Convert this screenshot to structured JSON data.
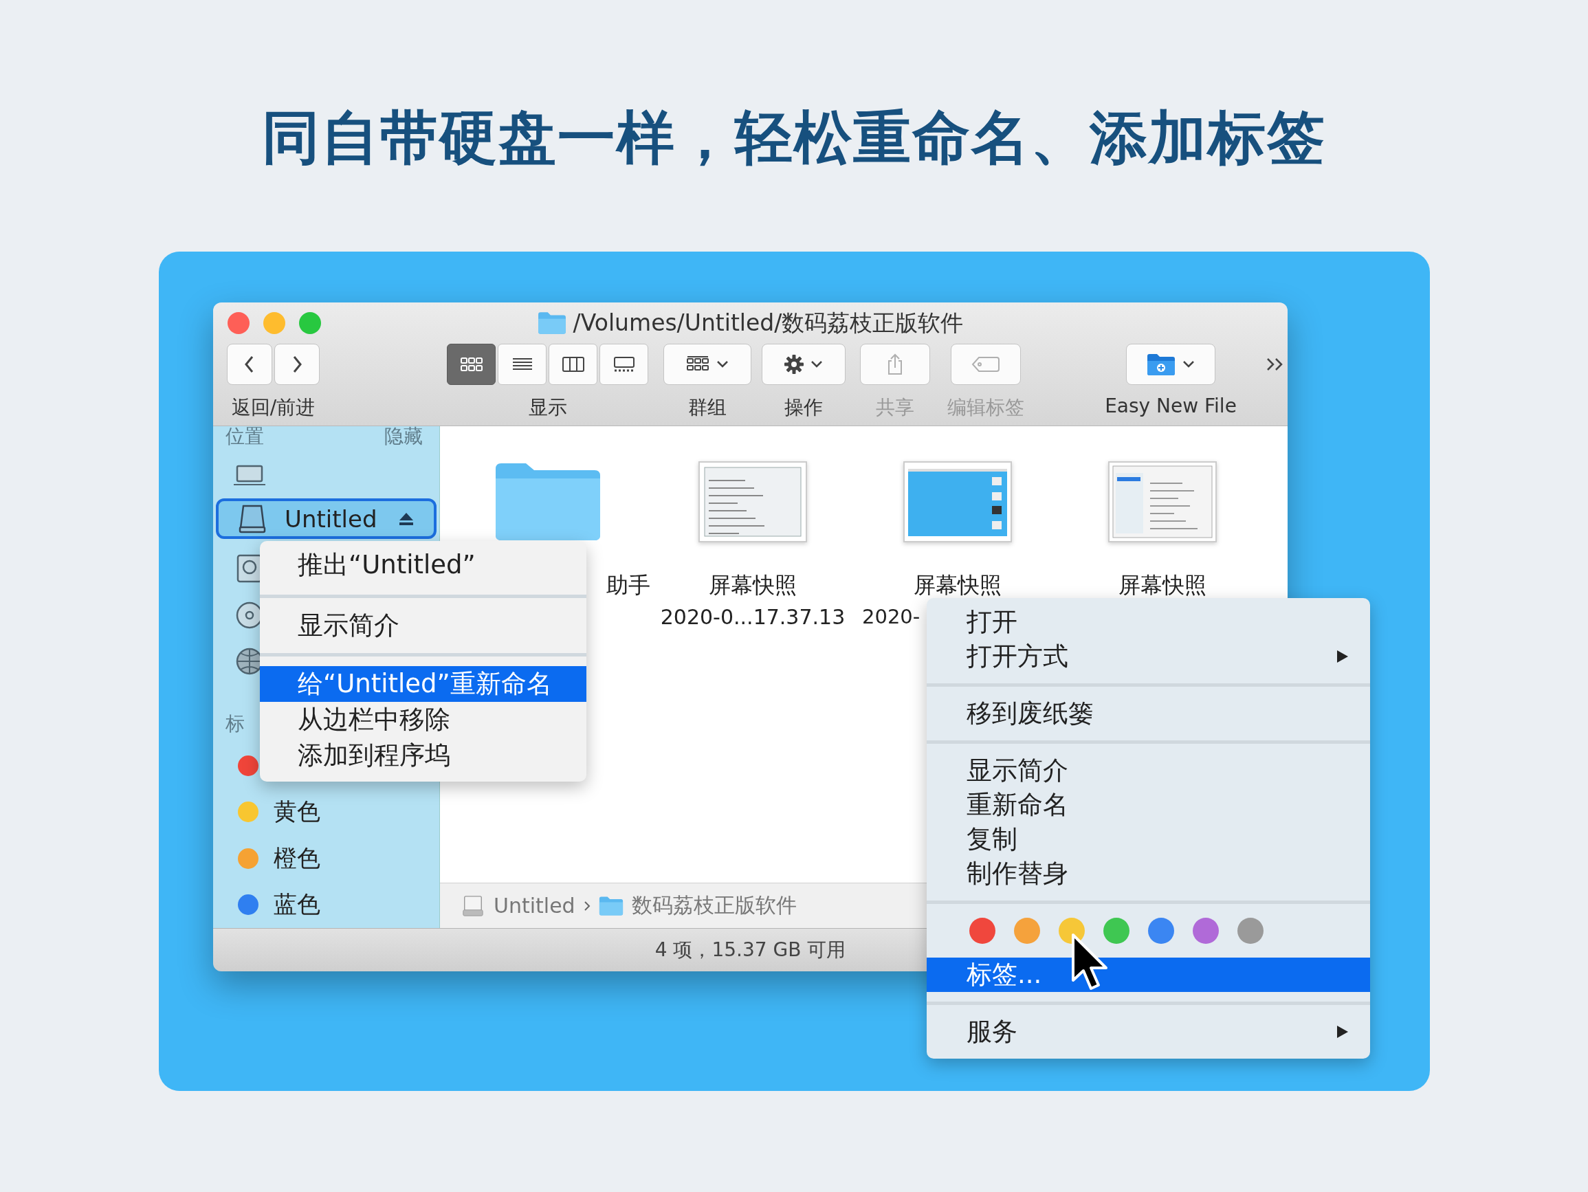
{
  "headline": "同自带硬盘一样，轻松重命名、添加标签",
  "window": {
    "title": "/Volumes/Untitled/数码荔枝正版软件",
    "toolbar": [
      {
        "kind": "nav",
        "label": "返回/前进",
        "disabled": false
      },
      {
        "kind": "view",
        "label": "显示",
        "disabled": false,
        "segments": [
          {
            "kind": "icons",
            "selected": true
          },
          {
            "kind": "list",
            "selected": false
          },
          {
            "kind": "columns",
            "selected": false
          },
          {
            "kind": "gallery",
            "selected": false
          }
        ]
      },
      {
        "kind": "group",
        "label": "群组",
        "disabled": false
      },
      {
        "kind": "action",
        "label": "操作",
        "disabled": false
      },
      {
        "kind": "share",
        "label": "共享",
        "disabled": true
      },
      {
        "kind": "tags",
        "label": "编辑标签",
        "disabled": true
      },
      {
        "kind": "newfile",
        "label": "Easy New File",
        "disabled": false
      },
      {
        "kind": "more",
        "disabled": false
      }
    ],
    "sidebar": [
      {
        "title": "位置",
        "action": "隐藏",
        "items": [
          {
            "kind": "laptop",
            "selected": false
          },
          {
            "kind": "drive",
            "label": "Untitled",
            "selected": true
          },
          {
            "kind": "backup",
            "selected": false
          },
          {
            "kind": "disc",
            "selected": false
          },
          {
            "kind": "network",
            "selected": false
          }
        ]
      },
      {
        "title": "标",
        "items": [
          {
            "kind": "tag",
            "color": "#f0453a",
            "selected": false
          },
          {
            "kind": "tag",
            "label": "黄色",
            "color": "#f8c630",
            "selected": false
          },
          {
            "kind": "tag",
            "label": "橙色",
            "color": "#f5a233",
            "selected": false
          },
          {
            "kind": "tag",
            "label": "蓝色",
            "color": "#2f7ff0",
            "selected": false
          }
        ]
      }
    ],
    "files": [
      {
        "kind": "folder",
        "name": "助手"
      },
      {
        "kind": "menu-shot",
        "name": "屏幕快照",
        "detail": "2020-0...17.37.13"
      },
      {
        "kind": "desktop-shot",
        "name": "屏幕快照",
        "detail": "2020-"
      },
      {
        "kind": "window-shot",
        "name": "屏幕快照"
      }
    ],
    "path_bar": [
      {
        "kind": "drive",
        "label": "Untitled"
      },
      {
        "kind": "folder",
        "label": "数码荔枝正版软件"
      }
    ],
    "status": "4 项，15.37 GB 可用"
  },
  "sidebar_menu": [
    [
      {
        "label": "推出“Untitled”",
        "selected": false
      }
    ],
    [
      {
        "label": "显示简介",
        "selected": false
      }
    ],
    [
      {
        "label": "给“Untitled”重新命名",
        "selected": true
      },
      {
        "label": "从边栏中移除",
        "selected": false
      },
      {
        "label": "添加到程序坞",
        "selected": false
      }
    ]
  ],
  "file_menu": [
    {
      "kind": "items",
      "items": [
        {
          "label": "打开",
          "selected": false,
          "submenu": false
        },
        {
          "label": "打开方式",
          "selected": false,
          "submenu": true
        }
      ]
    },
    {
      "kind": "items",
      "items": [
        {
          "label": "移到废纸篓",
          "selected": false,
          "submenu": false
        }
      ]
    },
    {
      "kind": "items",
      "items": [
        {
          "label": "显示简介",
          "selected": false,
          "submenu": false
        },
        {
          "label": "重新命名",
          "selected": false,
          "submenu": false
        },
        {
          "label": "复制",
          "selected": false,
          "submenu": false
        },
        {
          "label": "制作替身",
          "selected": false,
          "submenu": false
        }
      ]
    },
    {
      "kind": "colors",
      "colors": [
        {
          "color": "#f0473d"
        },
        {
          "color": "#f5a23c"
        },
        {
          "color": "#f6c738"
        },
        {
          "color": "#3fc752"
        },
        {
          "color": "#3b86f2"
        },
        {
          "color": "#b06ad8"
        },
        {
          "color": "#9a9a9a"
        }
      ],
      "items": [
        {
          "label": "标签...",
          "selected": true,
          "submenu": false
        }
      ]
    },
    {
      "kind": "items",
      "items": [
        {
          "label": "服务",
          "selected": false,
          "submenu": true
        }
      ]
    }
  ]
}
